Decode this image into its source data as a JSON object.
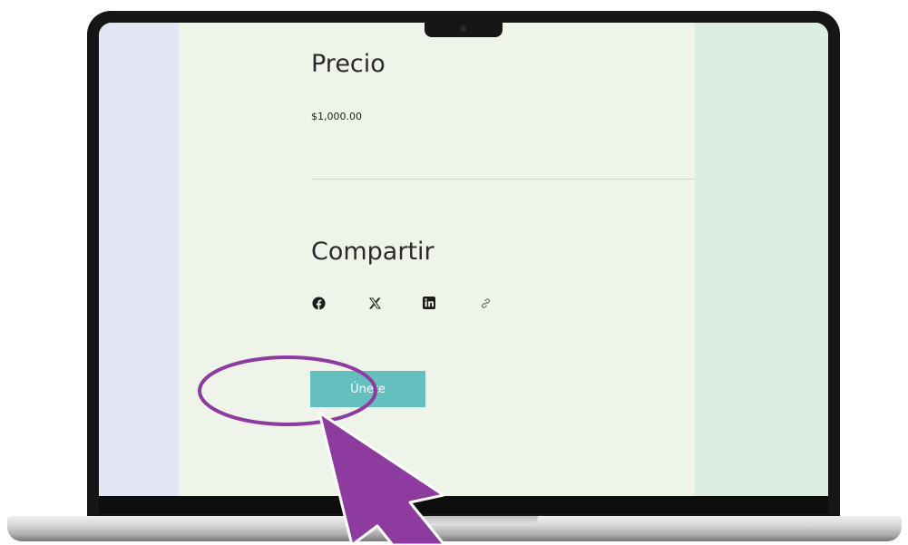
{
  "product": {
    "price_heading": "Precio",
    "price_value": "$1,000.00"
  },
  "share": {
    "heading": "Compartir",
    "icons": [
      "facebook-icon",
      "x-icon",
      "linkedin-icon",
      "link-icon"
    ]
  },
  "cta": {
    "label": "Únete"
  },
  "colors": {
    "button": "#66bfbf",
    "highlight": "#8e3ba0",
    "sidebar_left": "#e4e6f8",
    "content_bg": "#eef4ea",
    "sidebar_right": "#deede3"
  }
}
